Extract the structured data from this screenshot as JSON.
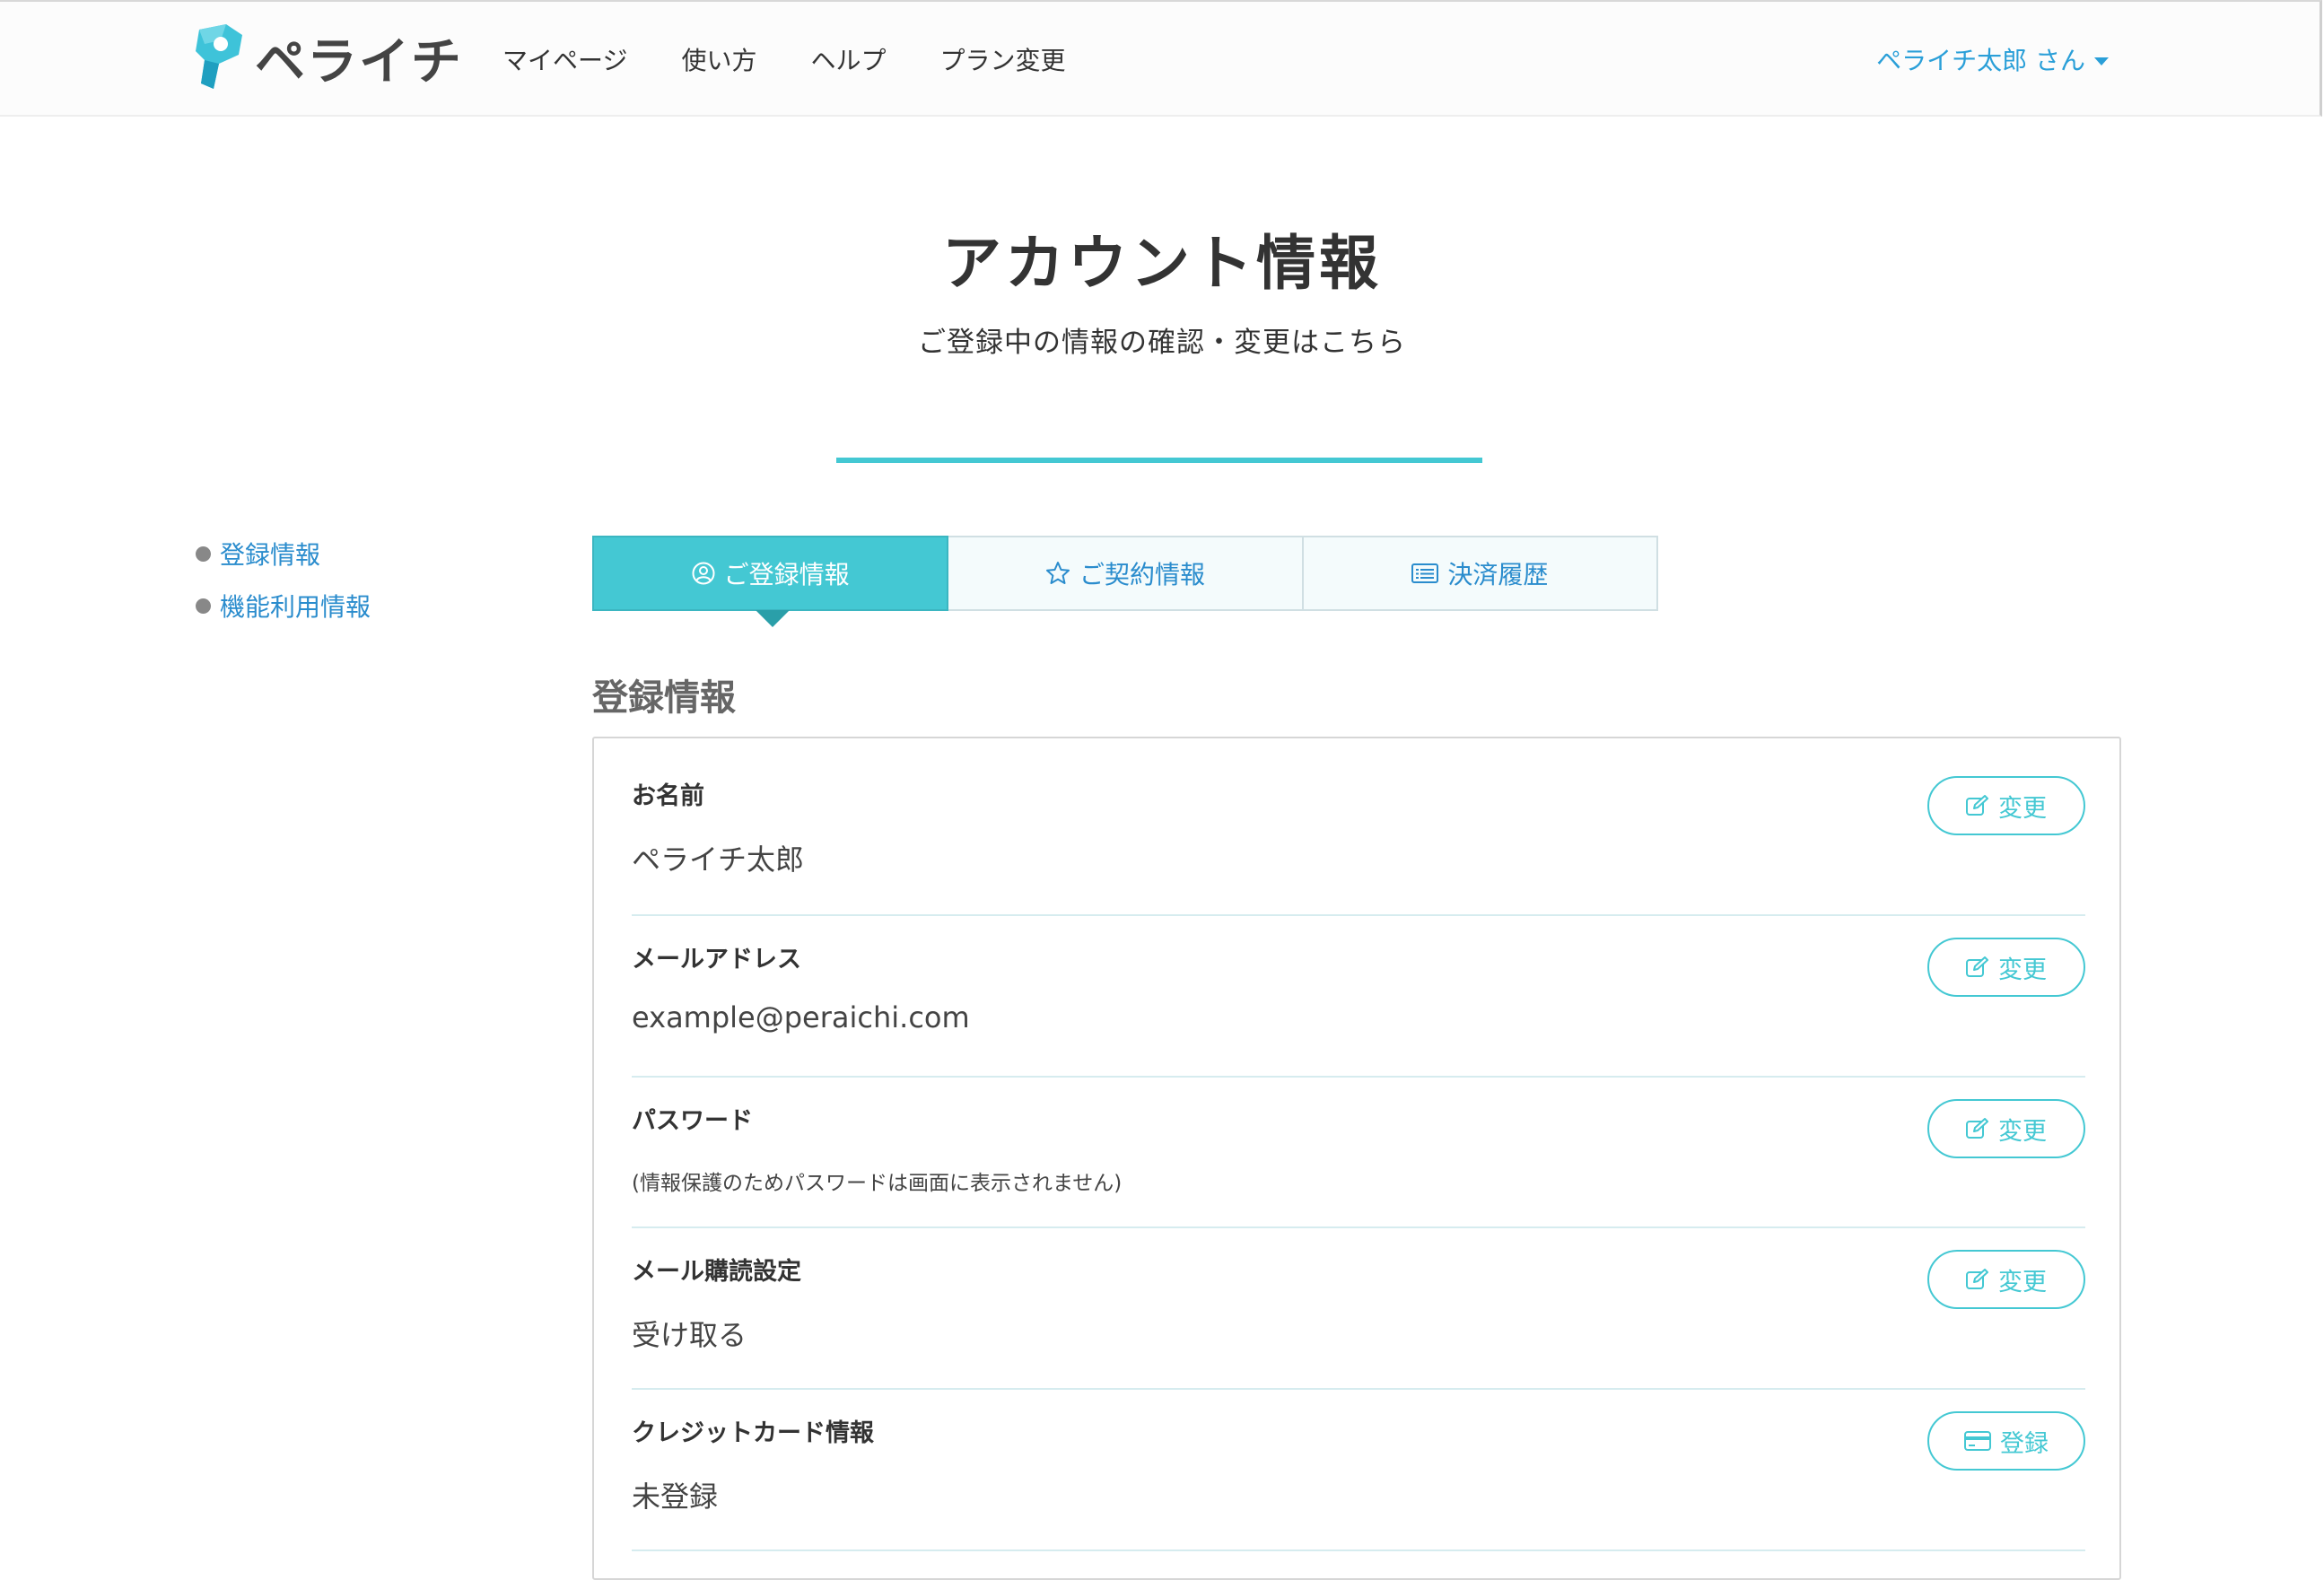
{
  "header": {
    "logo_text": "ペライチ",
    "nav": [
      "マイページ",
      "使い方",
      "ヘルプ",
      "プラン変更"
    ],
    "user_name": "ペライチ太郎 さん"
  },
  "page": {
    "title": "アカウント情報",
    "subtitle": "ご登録中の情報の確認・変更はこちら"
  },
  "sidebar": {
    "items": [
      {
        "label": "登録情報"
      },
      {
        "label": "機能利用情報"
      }
    ]
  },
  "tabs": [
    {
      "label": "ご登録情報",
      "icon": "user-circle-icon",
      "active": true
    },
    {
      "label": "ご契約情報",
      "icon": "star-icon",
      "active": false
    },
    {
      "label": "決済履歴",
      "icon": "list-icon",
      "active": false
    }
  ],
  "section": {
    "heading": "登録情報"
  },
  "rows": [
    {
      "label": "お名前",
      "value": "ペライチ太郎",
      "button": "変更",
      "button_icon": "edit-icon"
    },
    {
      "label": "メールアドレス",
      "value": "example@peraichi.com",
      "button": "変更",
      "button_icon": "edit-icon"
    },
    {
      "label": "パスワード",
      "value": "(情報保護のためパスワードは画面に表示されません)",
      "button": "変更",
      "button_icon": "edit-icon"
    },
    {
      "label": "メール購読設定",
      "value": "受け取る",
      "button": "変更",
      "button_icon": "edit-icon"
    },
    {
      "label": "クレジットカード情報",
      "value": "未登録",
      "button": "登録",
      "button_icon": "credit-card-icon"
    }
  ],
  "colors": {
    "accent": "#44c8d3",
    "link": "#2a8ccd",
    "user_link": "#2a9fd8"
  }
}
